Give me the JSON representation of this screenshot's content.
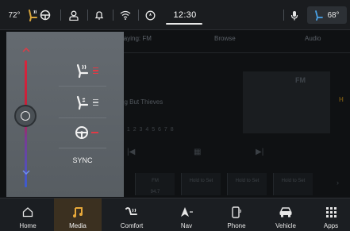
{
  "status_bar": {
    "outside_temp": "72°",
    "clock": "12:30",
    "driver_temp": "68°"
  },
  "media": {
    "tab_now_playing": "laying: FM",
    "tab_browse": "Browse",
    "tab_audio": "Audio",
    "station_text": "ng But Thieves",
    "band_label": "FM",
    "hd_badge": "H",
    "preset_band": "FM",
    "preset_freq": "94.7",
    "preset_hold_1": "Hold to Set",
    "preset_hold_2": "Hold to Set",
    "preset_hold_3": "Hold to Set"
  },
  "climate": {
    "sync_label": "SYNC",
    "accent_red": "#e23a45",
    "accent_blue": "#6f8ff0"
  },
  "nav": {
    "home": "Home",
    "media": "Media",
    "comfort": "Comfort",
    "nav": "Nav",
    "phone": "Phone",
    "vehicle": "Vehicle",
    "apps": "Apps"
  }
}
